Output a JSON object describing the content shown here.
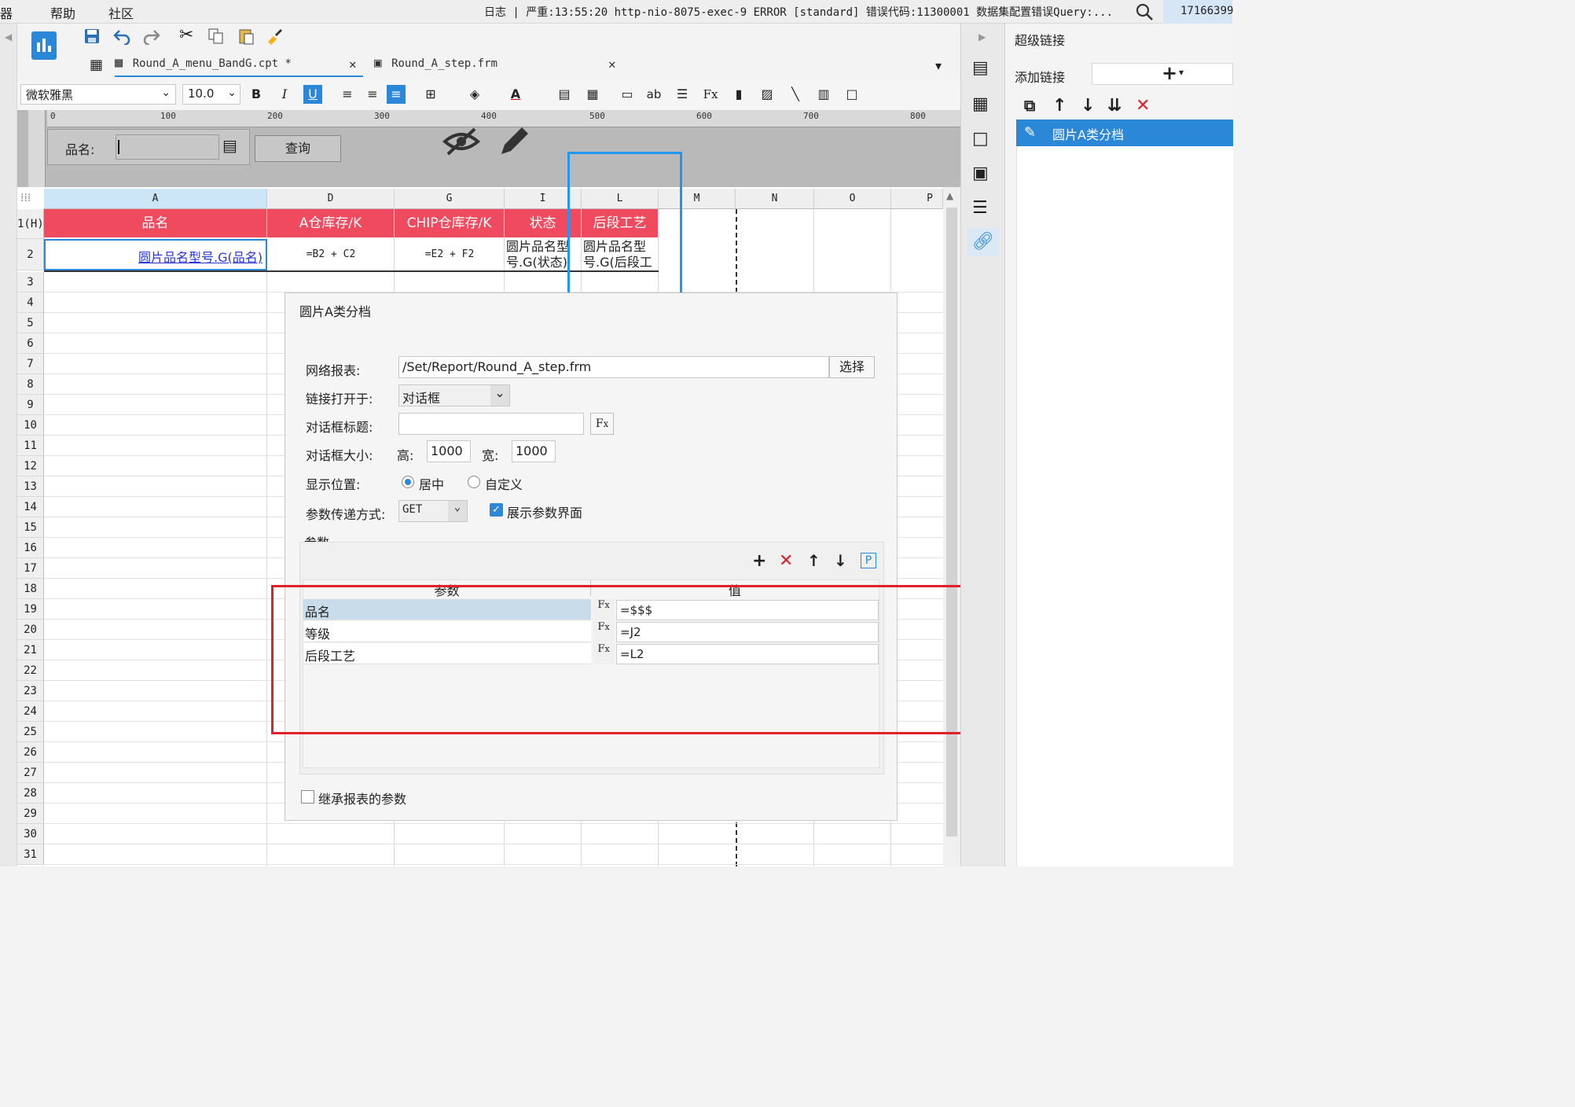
{
  "menubar": {
    "items": [
      "器",
      "帮助",
      "社区"
    ],
    "log_label": "日志 | 严重:13:55:20 http-nio-8075-exec-9 ERROR [standard] 错误代码:11300001 数据集配置错误Query:...",
    "build": "17166399"
  },
  "tabs": [
    {
      "label": "Round_A_menu_BandG.cpt *"
    },
    {
      "label": "Round_A_step.frm"
    }
  ],
  "format": {
    "font": "微软雅黑",
    "size": "10.0"
  },
  "ruler_ticks": [
    "0",
    "100",
    "200",
    "300",
    "400",
    "500",
    "600",
    "700",
    "800"
  ],
  "param_panel": {
    "label": "品名:",
    "query_button": "查询"
  },
  "columns": [
    "A",
    "D",
    "G",
    "I",
    "L",
    "M",
    "N",
    "O",
    "P"
  ],
  "rows": [
    "1(H)",
    "2",
    "3",
    "4",
    "5",
    "6",
    "7",
    "8",
    "9",
    "10",
    "11",
    "12",
    "13",
    "14",
    "15",
    "16",
    "17",
    "18",
    "19",
    "20",
    "21",
    "22",
    "23",
    "24",
    "25",
    "26",
    "27",
    "28",
    "29",
    "30",
    "31"
  ],
  "header_row": [
    "品名",
    "A仓库存/K",
    "CHIP仓库存/K",
    "状态",
    "后段工艺"
  ],
  "data_row": {
    "a": "圆片品名型号.G(品名)",
    "d": "=B2 + C2",
    "g": "=E2 + F2",
    "i": "圆片品名型号.G(状态)",
    "l": "圆片品名型号.G(后段工"
  },
  "dialog": {
    "title": "圆片A类分档",
    "report_label": "网络报表:",
    "report_path": "/Set/Report/Round_A_step.frm",
    "choose_button": "选择",
    "open_in_label": "链接打开于:",
    "open_in_value": "对话框",
    "dialog_title_label": "对话框标题:",
    "dialog_size_label": "对话框大小:",
    "height_label": "高:",
    "height_value": "1000",
    "width_label": "宽:",
    "width_value": "1000",
    "position_label": "显示位置:",
    "position_center": "居中",
    "position_custom": "自定义",
    "method_label": "参数传递方式:",
    "method_value": "GET",
    "show_params_label": "展示参数界面",
    "params_section": "参数",
    "params_headers": [
      "参数",
      "值"
    ],
    "params": [
      {
        "name": "品名",
        "value": "=$$$"
      },
      {
        "name": "等级",
        "value": "=J2"
      },
      {
        "name": "后段工艺",
        "value": "=L2"
      }
    ],
    "inherit_label": "继承报表的参数"
  },
  "right_panel": {
    "title": "超级链接",
    "add_link": "添加链接",
    "links": [
      "圆片A类分档"
    ]
  },
  "colors": {
    "header_red": "#f04a5e",
    "accent_blue": "#2b88d8",
    "highlight_red": "#e0202a",
    "highlight_blue": "#2196f3"
  }
}
